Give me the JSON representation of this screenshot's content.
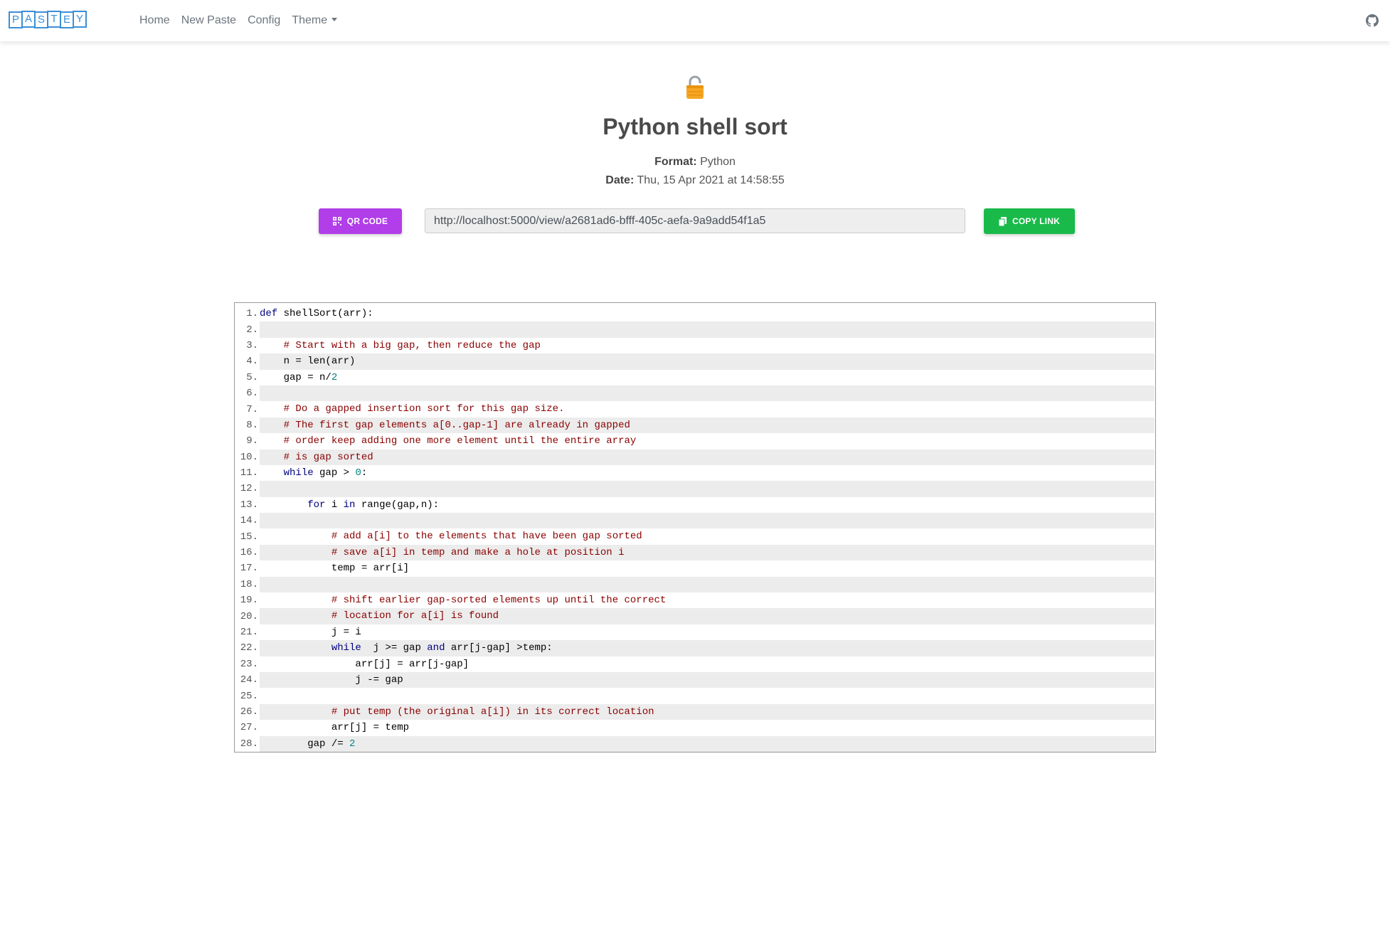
{
  "nav": {
    "logo_letters": [
      "P",
      "A",
      "S",
      "T",
      "E",
      "Y"
    ],
    "links": [
      "Home",
      "New Paste",
      "Config",
      "Theme"
    ],
    "github_icon": "github-icon"
  },
  "paste": {
    "title": "Python shell sort",
    "format_label": "Format:",
    "format_value": "Python",
    "date_label": "Date:",
    "date_value": "Thu, 15 Apr 2021 at 14:58:55",
    "lock_icon": "unlocked-padlock-icon"
  },
  "actions": {
    "qr_label": "QR CODE",
    "url": "http://localhost:5000/view/a2681ad6-bfff-405c-aefa-9a9add54f1a5",
    "copy_label": "COPY LINK"
  },
  "colors": {
    "qr_button": "#b13ee8",
    "copy_button": "#1aba4a",
    "logo": "#3a8fd8",
    "keyword": "#000080",
    "comment": "#8b0000",
    "number": "#008080"
  },
  "code": {
    "lines": [
      [
        [
          "kw",
          "def"
        ],
        [
          "t",
          " shellSort(arr):"
        ]
      ],
      [],
      [
        [
          "t",
          "    "
        ],
        [
          "cm",
          "# Start with a big gap, then reduce the gap"
        ]
      ],
      [
        [
          "t",
          "    n = len(arr)"
        ]
      ],
      [
        [
          "t",
          "    gap = n/"
        ],
        [
          "num",
          "2"
        ]
      ],
      [],
      [
        [
          "t",
          "    "
        ],
        [
          "cm",
          "# Do a gapped insertion sort for this gap size."
        ]
      ],
      [
        [
          "t",
          "    "
        ],
        [
          "cm",
          "# The first gap elements a[0..gap-1] are already in gapped"
        ]
      ],
      [
        [
          "t",
          "    "
        ],
        [
          "cm",
          "# order keep adding one more element until the entire array"
        ]
      ],
      [
        [
          "t",
          "    "
        ],
        [
          "cm",
          "# is gap sorted"
        ]
      ],
      [
        [
          "t",
          "    "
        ],
        [
          "kw",
          "while"
        ],
        [
          "t",
          " gap > "
        ],
        [
          "num",
          "0"
        ],
        [
          "t",
          ":"
        ]
      ],
      [],
      [
        [
          "t",
          "        "
        ],
        [
          "kw",
          "for"
        ],
        [
          "t",
          " i "
        ],
        [
          "kw",
          "in"
        ],
        [
          "t",
          " range(gap,n):"
        ]
      ],
      [],
      [
        [
          "t",
          "            "
        ],
        [
          "cm",
          "# add a[i] to the elements that have been gap sorted"
        ]
      ],
      [
        [
          "t",
          "            "
        ],
        [
          "cm",
          "# save a[i] in temp and make a hole at position i"
        ]
      ],
      [
        [
          "t",
          "            temp = arr[i]"
        ]
      ],
      [],
      [
        [
          "t",
          "            "
        ],
        [
          "cm",
          "# shift earlier gap-sorted elements up until the correct"
        ]
      ],
      [
        [
          "t",
          "            "
        ],
        [
          "cm",
          "# location for a[i] is found"
        ]
      ],
      [
        [
          "t",
          "            j = i"
        ]
      ],
      [
        [
          "t",
          "            "
        ],
        [
          "kw",
          "while"
        ],
        [
          "t",
          "  j >= gap "
        ],
        [
          "kw",
          "and"
        ],
        [
          "t",
          " arr[j-gap] >temp:"
        ]
      ],
      [
        [
          "t",
          "                arr[j] = arr[j-gap]"
        ]
      ],
      [
        [
          "t",
          "                j -= gap"
        ]
      ],
      [],
      [
        [
          "t",
          "            "
        ],
        [
          "cm",
          "# put temp (the original a[i]) in its correct location"
        ]
      ],
      [
        [
          "t",
          "            arr[j] = temp"
        ]
      ],
      [
        [
          "t",
          "        gap /= "
        ],
        [
          "num",
          "2"
        ]
      ]
    ]
  }
}
